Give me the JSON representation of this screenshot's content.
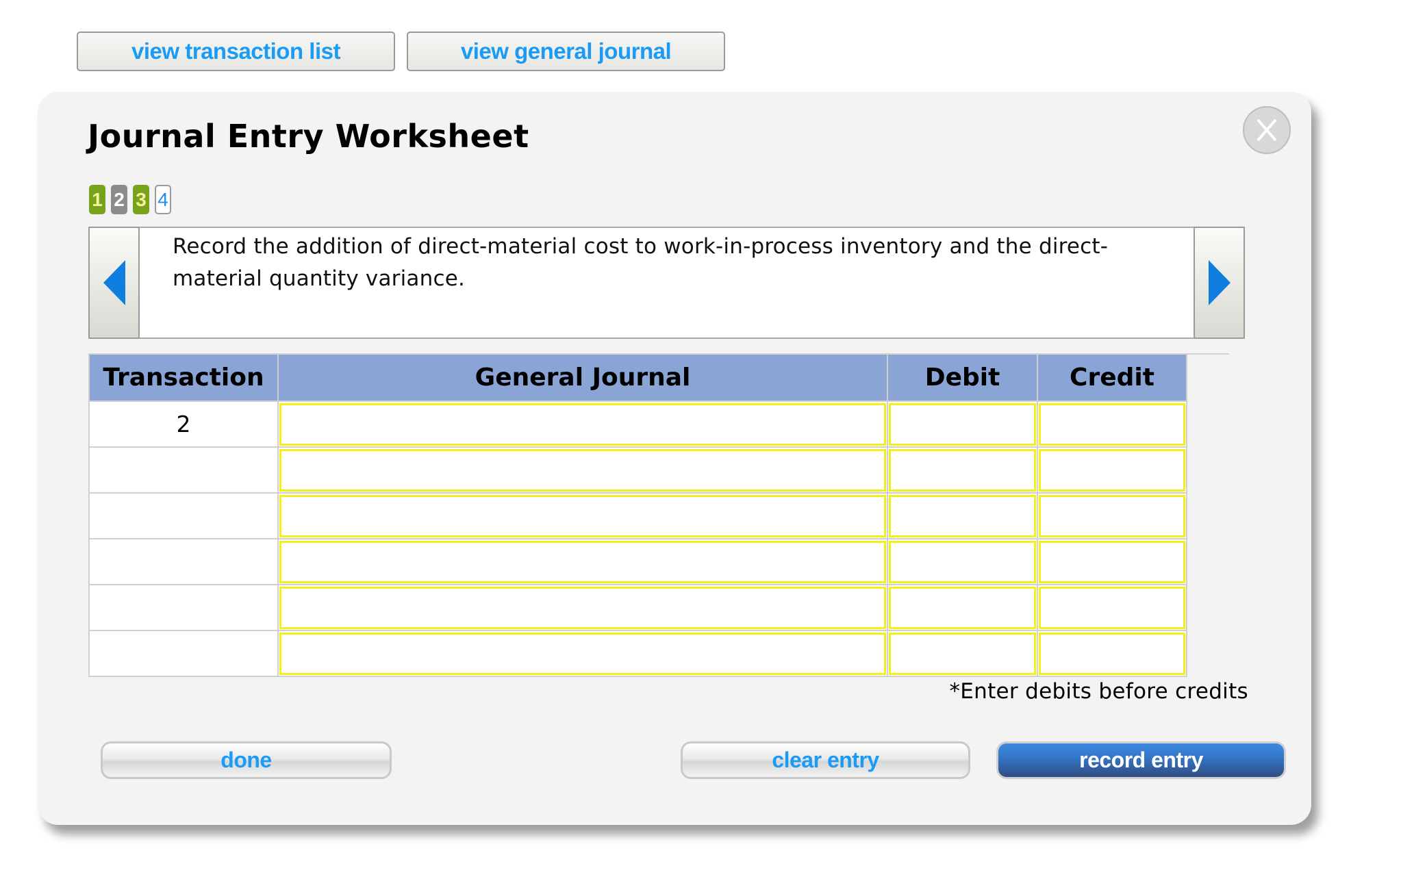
{
  "toolbar": {
    "view_transaction_list": "view transaction list",
    "view_general_journal": "view general journal"
  },
  "worksheet": {
    "title": "Journal Entry Worksheet",
    "close_label": "X",
    "steps": [
      {
        "label": "1",
        "state": "completed"
      },
      {
        "label": "2",
        "state": "skipped"
      },
      {
        "label": "3",
        "state": "completed"
      },
      {
        "label": "4",
        "state": "current"
      }
    ],
    "instruction": "Record the addition of direct-material cost to work-in-process inventory and the direct-material quantity variance.",
    "table": {
      "headers": [
        "Transaction",
        "General Journal",
        "Debit",
        "Credit"
      ],
      "rows": [
        {
          "transaction": "2",
          "account": "",
          "debit": "",
          "credit": ""
        },
        {
          "transaction": "",
          "account": "",
          "debit": "",
          "credit": ""
        },
        {
          "transaction": "",
          "account": "",
          "debit": "",
          "credit": ""
        },
        {
          "transaction": "",
          "account": "",
          "debit": "",
          "credit": ""
        },
        {
          "transaction": "",
          "account": "",
          "debit": "",
          "credit": ""
        },
        {
          "transaction": "",
          "account": "",
          "debit": "",
          "credit": ""
        }
      ]
    },
    "note": "*Enter debits before credits",
    "buttons": {
      "done": "done",
      "clear_entry": "clear entry",
      "record_entry": "record entry"
    }
  },
  "colors": {
    "link_blue": "#1a9bf5",
    "header_blue": "#8aa5d5",
    "input_border_yellow": "#f2ef1a",
    "step_completed_green": "#77a21a",
    "step_skipped_gray": "#8b8b8b",
    "arrow_blue": "#0f7ee0",
    "record_button_blue": "#3477c8"
  },
  "icons": {
    "prev": "left-triangle",
    "next": "right-triangle",
    "close": "x-circle"
  }
}
